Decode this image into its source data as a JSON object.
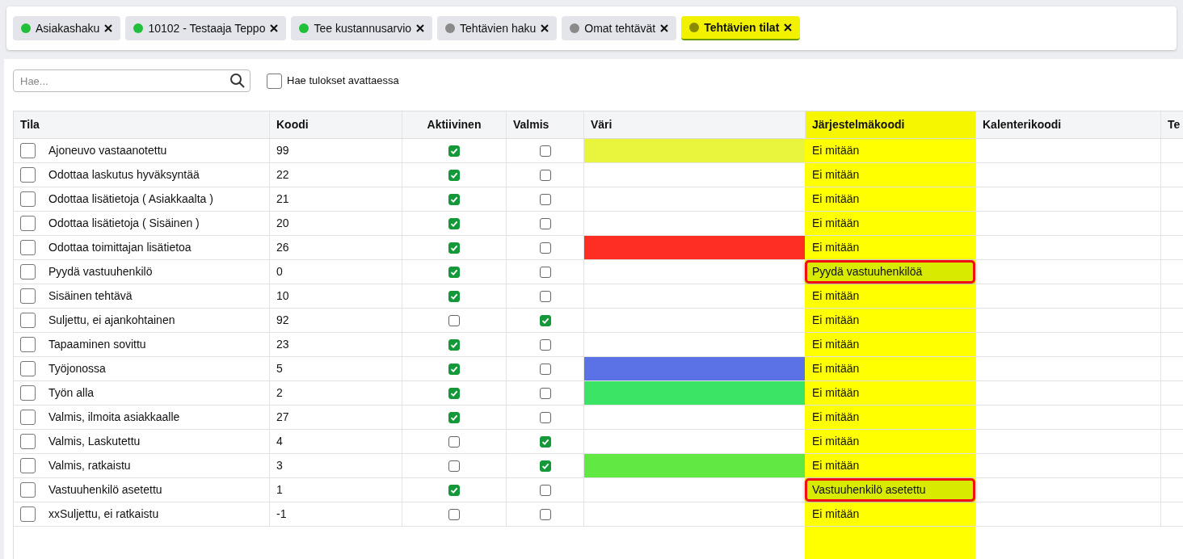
{
  "tabs": [
    {
      "label": "Asiakashaku",
      "color": "#22c03a",
      "selected": false
    },
    {
      "label": "10102 - Testaaja Teppo",
      "color": "#22c03a",
      "selected": false
    },
    {
      "label": "Tee kustannusarvio",
      "color": "#22c03a",
      "selected": false
    },
    {
      "label": "Tehtävien haku",
      "color": "#8a8a8a",
      "selected": false
    },
    {
      "label": "Omat tehtävät",
      "color": "#8a8a8a",
      "selected": false
    },
    {
      "label": "Tehtävien tilat",
      "color": "#8a8a00",
      "selected": true
    }
  ],
  "search": {
    "placeholder": "Hae..."
  },
  "open_search": {
    "label": "Hae tulokset avattaessa",
    "checked": false
  },
  "table": {
    "columns": [
      "Tila",
      "Koodi",
      "Aktiivinen",
      "Valmis",
      "Väri",
      "Järjestelmäkoodi",
      "Kalenterikoodi",
      "Te"
    ],
    "rows": [
      {
        "name": "Ajoneuvo vastaanotettu",
        "code": "99",
        "active": true,
        "done": false,
        "color": "#e8f53c",
        "system": "Ei mitään",
        "highlighted": false,
        "selected": false
      },
      {
        "name": "Odottaa laskutus hyväksyntää",
        "code": "22",
        "active": true,
        "done": false,
        "system": "Ei mitään",
        "highlighted": false,
        "selected": false
      },
      {
        "name": "Odottaa lisätietoja ( Asiakkaalta )",
        "code": "21",
        "active": true,
        "done": false,
        "system": "Ei mitään",
        "highlighted": false,
        "selected": false
      },
      {
        "name": "Odottaa lisätietoja ( Sisäinen )",
        "code": "20",
        "active": true,
        "done": false,
        "system": "Ei mitään",
        "highlighted": false,
        "selected": false
      },
      {
        "name": "Odottaa toimittajan lisätietoa",
        "code": "26",
        "active": true,
        "done": false,
        "color": "#ff2e22",
        "system": "Ei mitään",
        "highlighted": false,
        "selected": false
      },
      {
        "name": "Pyydä vastuuhenkilö",
        "code": "0",
        "active": true,
        "done": false,
        "system": "Pyydä vastuuhenkilöä",
        "highlighted": true,
        "selected": false
      },
      {
        "name": "Sisäinen tehtävä",
        "code": "10",
        "active": true,
        "done": false,
        "system": "Ei mitään",
        "highlighted": false,
        "selected": false
      },
      {
        "name": "Suljettu, ei ajankohtainen",
        "code": "92",
        "active": false,
        "done": true,
        "system": "Ei mitään",
        "highlighted": false,
        "selected": false
      },
      {
        "name": "Tapaaminen sovittu",
        "code": "23",
        "active": true,
        "done": false,
        "system": "Ei mitään",
        "highlighted": false,
        "selected": false
      },
      {
        "name": "Työjonossa",
        "code": "5",
        "active": true,
        "done": false,
        "color": "#5a72e6",
        "system": "Ei mitään",
        "highlighted": false,
        "selected": false
      },
      {
        "name": "Työn alla",
        "code": "2",
        "active": true,
        "done": false,
        "color": "#3ce465",
        "system": "Ei mitään",
        "highlighted": false,
        "selected": false
      },
      {
        "name": "Valmis, ilmoita asiakkaalle",
        "code": "27",
        "active": true,
        "done": false,
        "system": "Ei mitään",
        "highlighted": false,
        "selected": false
      },
      {
        "name": "Valmis, Laskutettu",
        "code": "4",
        "active": false,
        "done": true,
        "system": "Ei mitään",
        "highlighted": false,
        "selected": false
      },
      {
        "name": "Valmis, ratkaistu",
        "code": "3",
        "active": false,
        "done": true,
        "color": "#62e842",
        "system": "Ei mitään",
        "highlighted": false,
        "selected": false
      },
      {
        "name": "Vastuuhenkilö asetettu",
        "code": "1",
        "active": true,
        "done": false,
        "system": "Vastuuhenkilö asetettu",
        "highlighted": true,
        "selected": false
      },
      {
        "name": "xxSuljettu, ei ratkaistu",
        "code": "-1",
        "active": false,
        "done": false,
        "system": "Ei mitään",
        "highlighted": false,
        "selected": false
      }
    ]
  }
}
